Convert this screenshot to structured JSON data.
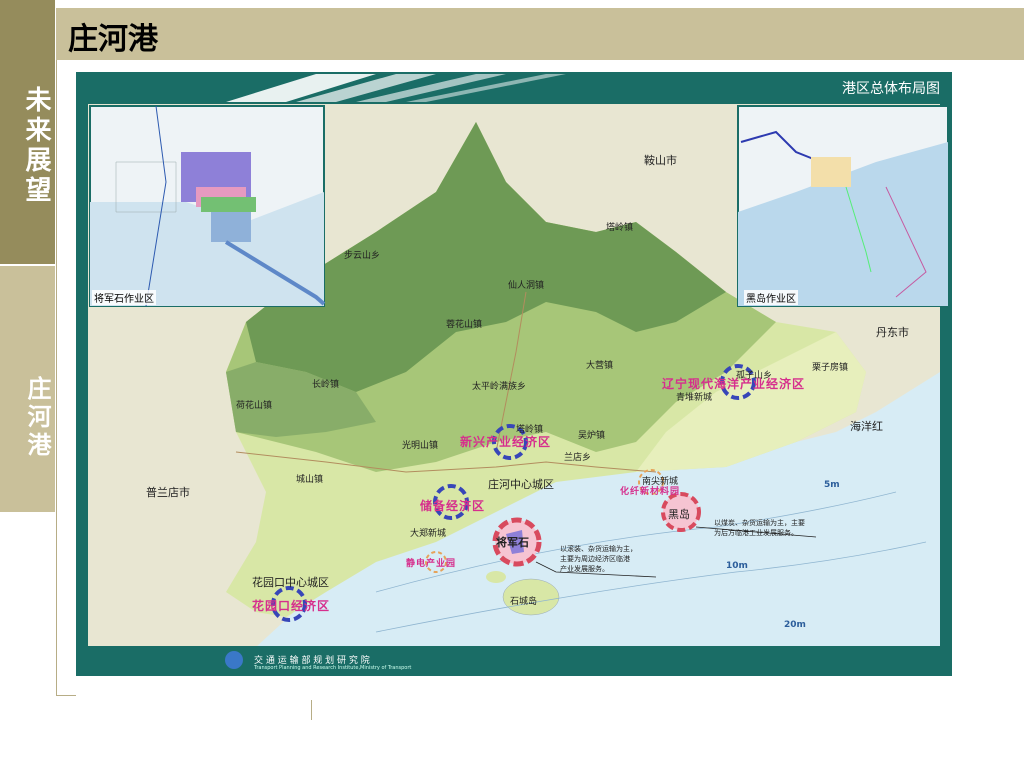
{
  "sidebar": {
    "tab_future": "未来展望",
    "tab_current": "庄河港"
  },
  "header": {
    "title": "庄河港"
  },
  "map": {
    "header": "港区总体布局图",
    "footer": "交 通 运 输 部 规 划 研 究 院",
    "footer_en": "Transport Planning and Research Institute,Ministry of Transport",
    "inset_left_label": "将军石作业区",
    "inset_right_label": "黑岛作业区",
    "towns": {
      "anshan": "鞍山市",
      "buyun": "步云山乡",
      "taling": "塔岭镇",
      "xianren": "仙人洞镇",
      "guihua": "蓉花山镇",
      "dandong": "丹东市",
      "lizi": "栗子房镇",
      "heihuashan": "荷花山镇",
      "changling": "长岭镇",
      "taipingling": "太平岭满族乡",
      "daying": "大营镇",
      "qingdui": "青堆新城",
      "haiyanghong": "海洋红",
      "guangming": "光明山镇",
      "taling2": "塔岭镇",
      "wulu": "吴炉镇",
      "landian": "兰店乡",
      "chengshan": "城山镇",
      "pulandian": "普兰店市",
      "center": "庄河中心城区",
      "nanjian": "南尖新城",
      "heidao": "黑岛",
      "dazheng": "大郑新城",
      "jiangjunshi": "将军石",
      "shichengdao": "石城岛",
      "huayuankou": "花园口中心城区",
      "gushi": "孤子山乡"
    },
    "zones": {
      "liaoning": "辽宁现代海洋产业经济区",
      "xinxing": "新兴产业经济区",
      "chubei": "储备经济区",
      "jingdian": "静电产业园",
      "huagong": "化纤新材料园",
      "huayuankou": "花园口经济区"
    },
    "notes": {
      "heidao": [
        "以煤炭、杂货运输为主，主要",
        "为后方临港工业发展服务。"
      ],
      "jiangjunshi": [
        "以滚装、杂货运输为主，",
        "主要为周边经济区临港",
        "产业发展服务。"
      ]
    },
    "depths": {
      "d5": "5m",
      "d10": "10m",
      "d20": "20m"
    }
  }
}
